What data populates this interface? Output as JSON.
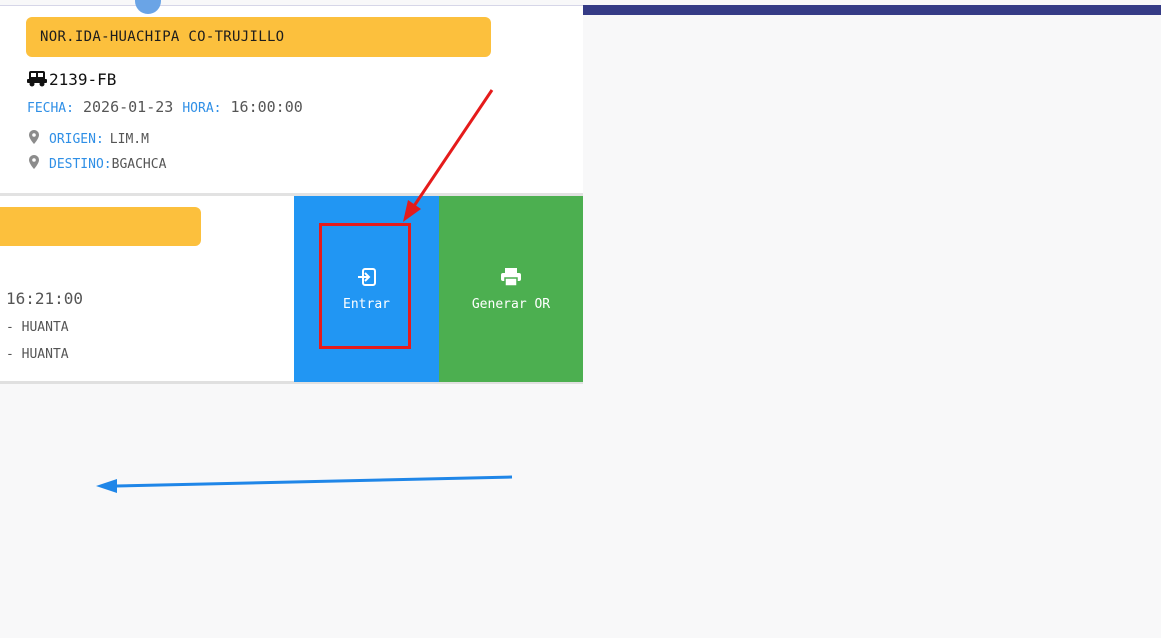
{
  "card_active": {
    "route": "NOR.IDA-HUACHIPA CO-TRUJILLO",
    "plate_icon": "bus-icon",
    "plate": "2139-FB",
    "fecha_label": "FECHA:",
    "fecha_value": "2026-01-23",
    "hora_label": "HORA:",
    "hora_value": "16:00:00",
    "origen_label": "ORIGEN:",
    "origen_value": "LIM.M",
    "destino_label": "DESTINO:",
    "destino_value": "BGACHCA",
    "location_icon": "map-pin-icon"
  },
  "card_swiped": {
    "route": "",
    "time": "16:21:00",
    "origen": "- HUANTA",
    "destino": "- HUANTA"
  },
  "actions": {
    "entrar_label": "Entrar",
    "entrar_icon": "login-icon",
    "generar_label": "Generar OR",
    "generar_icon": "printer-icon"
  },
  "annotations": {
    "red_arrow": "red-arrow-icon",
    "highlight": "red-highlight-box",
    "blue_arrow": "blue-arrow-left-icon"
  },
  "colors": {
    "route_badge": "#fcc03d",
    "label_blue": "#2f8fe6",
    "entrar_bg": "#2196f3",
    "generar_bg": "#4caf50",
    "header": "#353b86",
    "annotation_red": "#e51b1b",
    "annotation_blue": "#1f86e8"
  }
}
